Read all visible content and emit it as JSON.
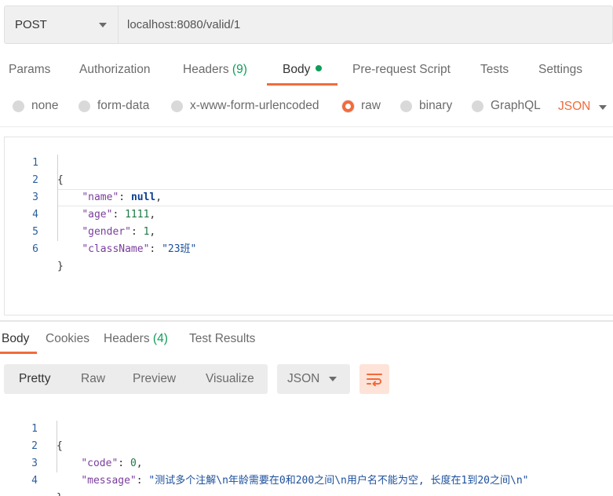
{
  "request": {
    "method": "POST",
    "url": "localhost:8080/valid/1"
  },
  "request_tabs": {
    "params": "Params",
    "authorization": "Authorization",
    "headers": "Headers",
    "headers_count": "(9)",
    "body": "Body",
    "pre_request": "Pre-request Script",
    "tests": "Tests",
    "settings": "Settings"
  },
  "body_types": {
    "none": "none",
    "form_data": "form-data",
    "urlencoded": "x-www-form-urlencoded",
    "raw": "raw",
    "binary": "binary",
    "graphql": "GraphQL",
    "language": "JSON",
    "selected": "raw"
  },
  "request_body": {
    "line_numbers": [
      "1",
      "2",
      "3",
      "4",
      "5",
      "6"
    ],
    "open_brace": "{",
    "close_brace": "}",
    "fields": [
      {
        "key": "\"name\"",
        "value": "null"
      },
      {
        "key": "\"age\"",
        "value": "1111"
      },
      {
        "key": "\"gender\"",
        "value": "1"
      },
      {
        "key": "\"className\"",
        "value": "\"23班\""
      }
    ]
  },
  "response_tabs": {
    "body": "Body",
    "cookies": "Cookies",
    "headers": "Headers",
    "headers_count": "(4)",
    "test_results": "Test Results"
  },
  "response_toolbar": {
    "pretty": "Pretty",
    "raw": "Raw",
    "preview": "Preview",
    "visualize": "Visualize",
    "format": "JSON",
    "wrap_icon": "wrap-lines-icon"
  },
  "response_body": {
    "line_numbers": [
      "1",
      "2",
      "3",
      "4"
    ],
    "open_brace": "{",
    "close_brace": "}",
    "fields": [
      {
        "key": "\"code\"",
        "value": "0"
      },
      {
        "key": "\"message\"",
        "value": "\"测试多个注解\\n年龄需要在0和200之间\\n用户名不能为空, 长度在1到20之间\\n\""
      }
    ]
  },
  "colors": {
    "accent": "#f26b3a",
    "count_green": "#0f9d58",
    "line_number": "#2b5f9c",
    "json_key": "#7a3e9d",
    "json_string": "#1b4f9c",
    "json_number": "#1d7a46"
  }
}
